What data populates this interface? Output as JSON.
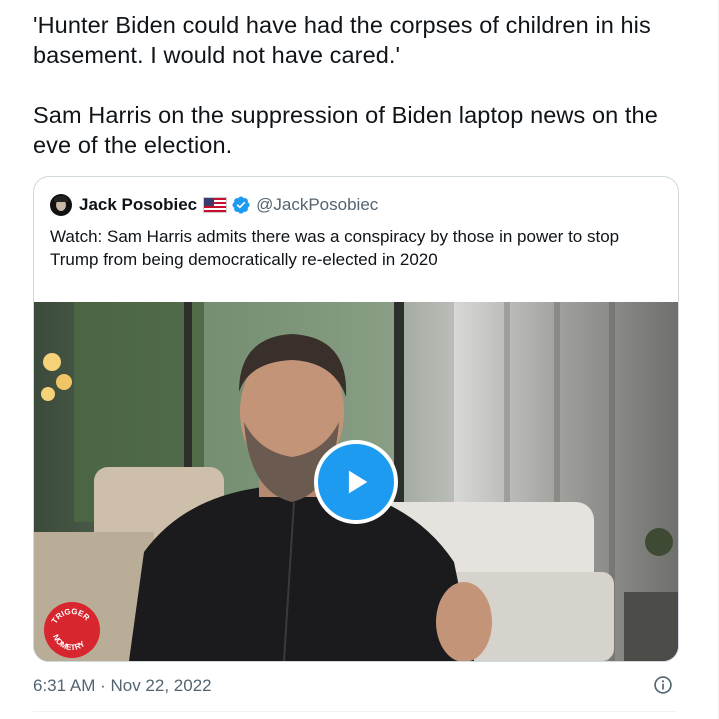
{
  "tweet": {
    "text_paragraphs": [
      "'Hunter Biden could have had the corpses of children in his basement. I would not have cared.'",
      "Sam Harris on the suppression of Biden laptop news on the eve of the election."
    ],
    "timestamp": "6:31 AM · Nov 22, 2022"
  },
  "quoted_tweet": {
    "display_name": "Jack Posobiec",
    "handle": "@JackPosobiec",
    "text": "Watch: Sam Harris admits there was a conspiracy by those in power to stop Trump from being democratically re-elected in 2020",
    "name_flag_icon": "us-flag-icon",
    "verified_icon": "verified-badge-icon",
    "media": {
      "type": "video",
      "play_icon": "play-icon",
      "watermark_text": "TRIGGER NOMETRY"
    }
  },
  "icons": {
    "info": "info-icon"
  },
  "colors": {
    "accent": "#1d9bf0",
    "secondary_text": "#536471",
    "primary_text": "#0f1419",
    "border": "#cfd9de",
    "watermark_red": "#d8262f"
  }
}
